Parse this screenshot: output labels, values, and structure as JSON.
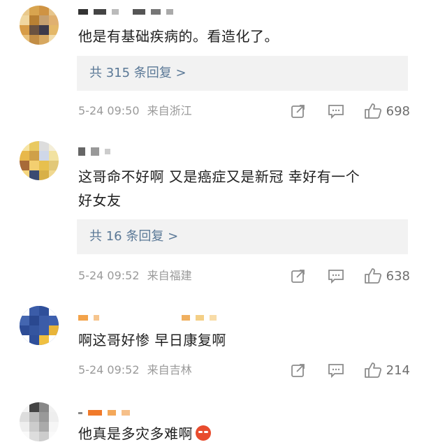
{
  "comments": [
    {
      "text": "他是有基础疾病的。看造化了。",
      "reply_label": "共 315 条回复 >",
      "time": "5-24 09:50",
      "location": "来自浙江",
      "likes": "698",
      "avatar_color": "#d9a24a"
    },
    {
      "text_line1": "这哥命不好啊 又是癌症又是新冠 幸好有一个",
      "text_line2": "好女友",
      "reply_label": "共 16 条回复 >",
      "time": "5-24 09:52",
      "location": "来自福建",
      "likes": "638",
      "avatar_color": "#f0d070"
    },
    {
      "text": "啊这哥好惨 早日康复啊",
      "time": "5-24 09:52",
      "location": "来自吉林",
      "likes": "214",
      "avatar_color": "#3b5ca8"
    },
    {
      "text": "他真是多灾多难啊",
      "emoji": "angry-face-emoji",
      "avatar_color": "#cccccc"
    }
  ],
  "icons": [
    "share-icon",
    "comment-icon",
    "like-icon"
  ]
}
